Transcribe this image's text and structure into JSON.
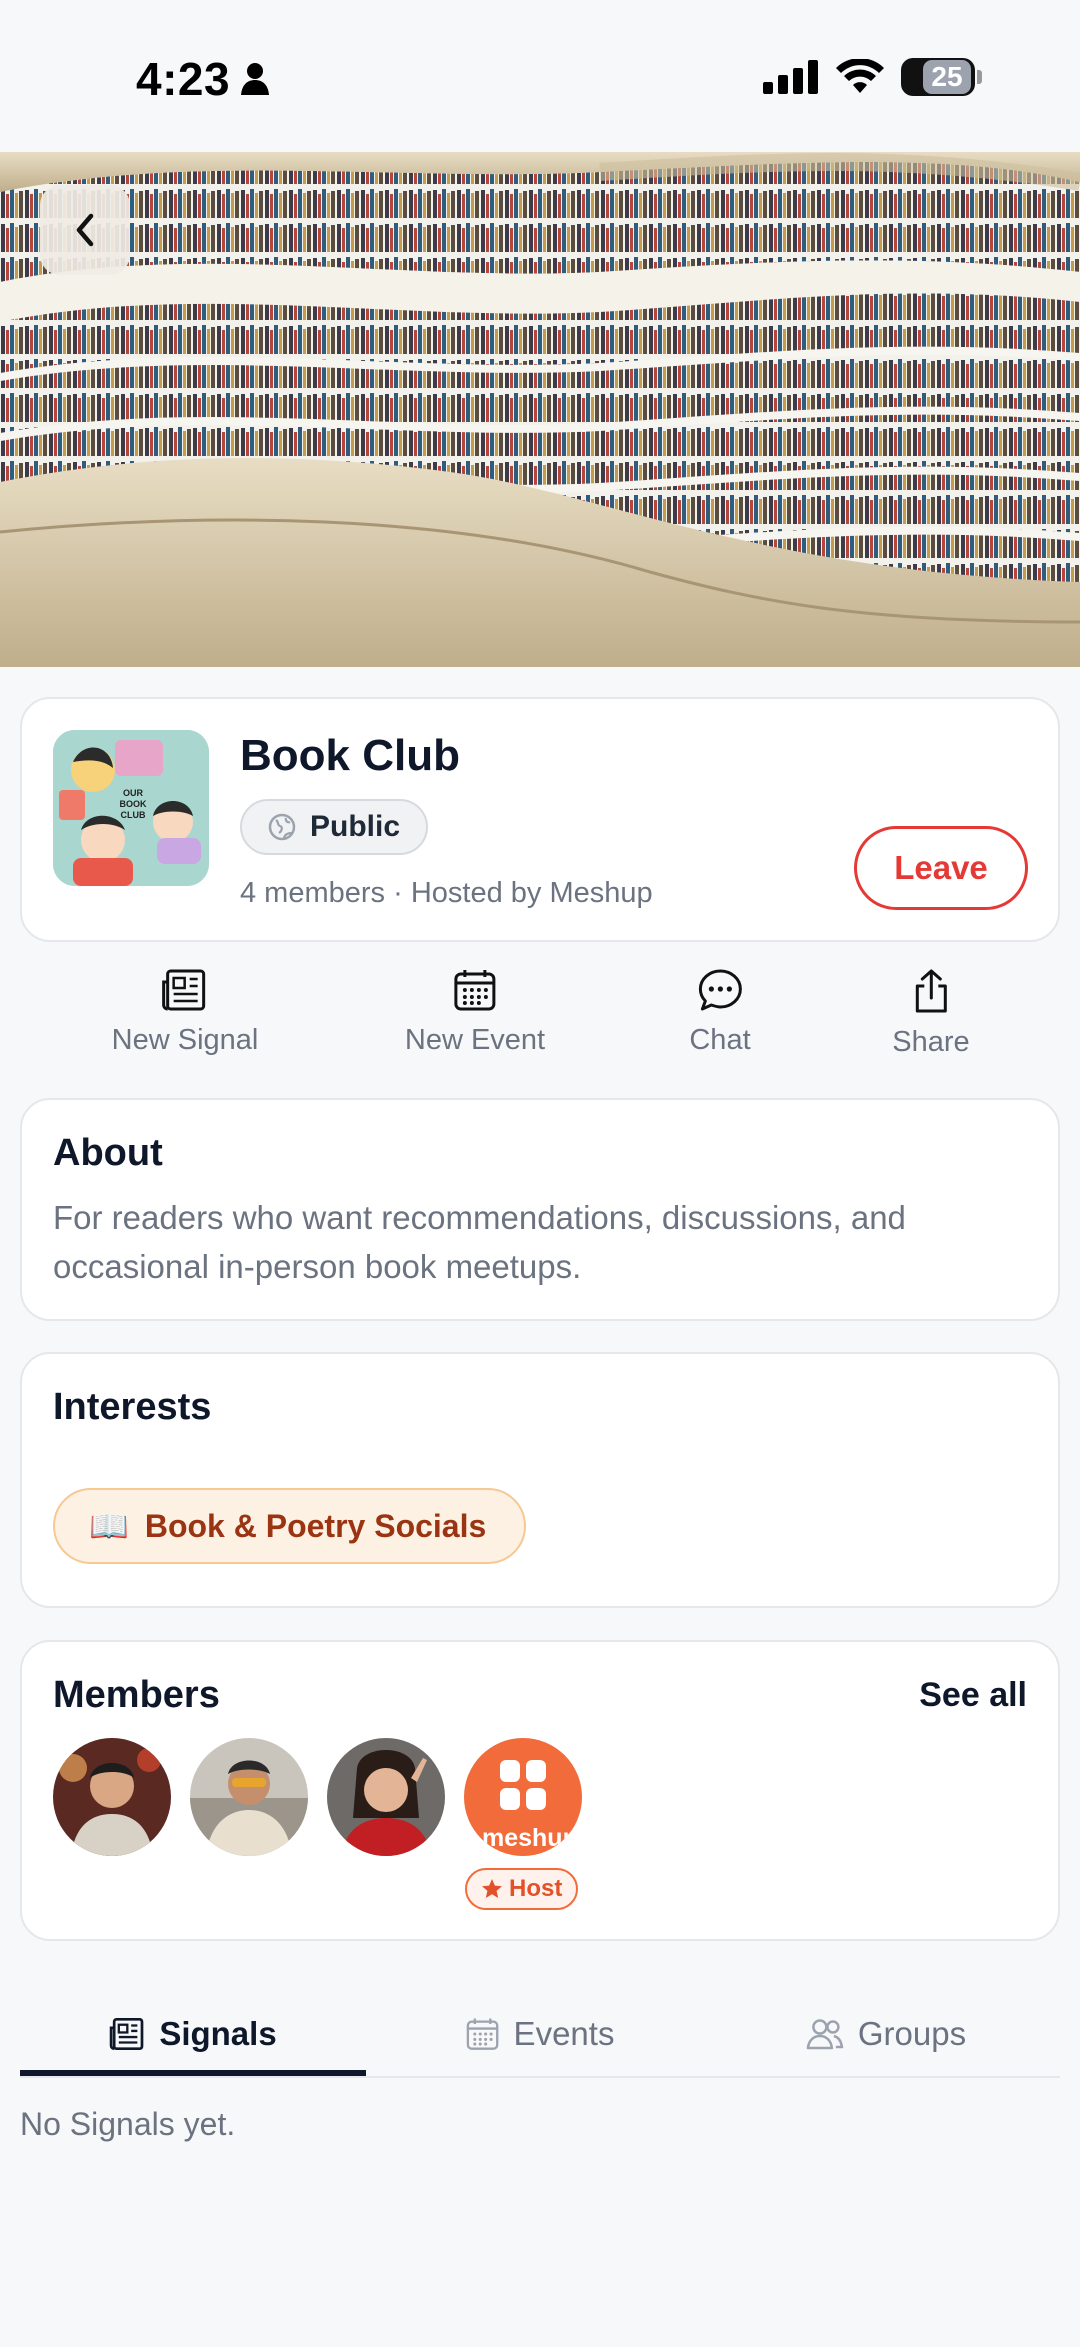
{
  "status_bar": {
    "time": "4:23",
    "battery": "25"
  },
  "group": {
    "title": "Book Club",
    "visibility": "Public",
    "meta": "4 members · Hosted by Meshup",
    "leave_label": "Leave",
    "avatar_text": "OUR BOOK CLUB"
  },
  "actions": [
    {
      "label": "New Signal",
      "icon": "newspaper-icon"
    },
    {
      "label": "New Event",
      "icon": "calendar-icon"
    },
    {
      "label": "Chat",
      "icon": "chat-bubble-icon"
    },
    {
      "label": "Share",
      "icon": "share-icon"
    }
  ],
  "about": {
    "title": "About",
    "text": "For readers who want recommendations, discussions, and occasional in-person book meetups."
  },
  "interests": {
    "title": "Interests",
    "items": [
      {
        "emoji": "📖",
        "label": "Book & Poetry Socials"
      }
    ]
  },
  "members": {
    "title": "Members",
    "see_all": "See all",
    "host_badge": "Host",
    "host_avatar_text": "meshup"
  },
  "tabs": [
    {
      "label": "Signals",
      "icon": "newspaper-icon",
      "active": true
    },
    {
      "label": "Events",
      "icon": "calendar-icon",
      "active": false
    },
    {
      "label": "Groups",
      "icon": "people-icon",
      "active": false
    }
  ],
  "empty_state": "No Signals yet.",
  "colors": {
    "accent_red": "#e53935",
    "host_orange": "#f26b3a",
    "chip_brown": "#9a3412"
  }
}
